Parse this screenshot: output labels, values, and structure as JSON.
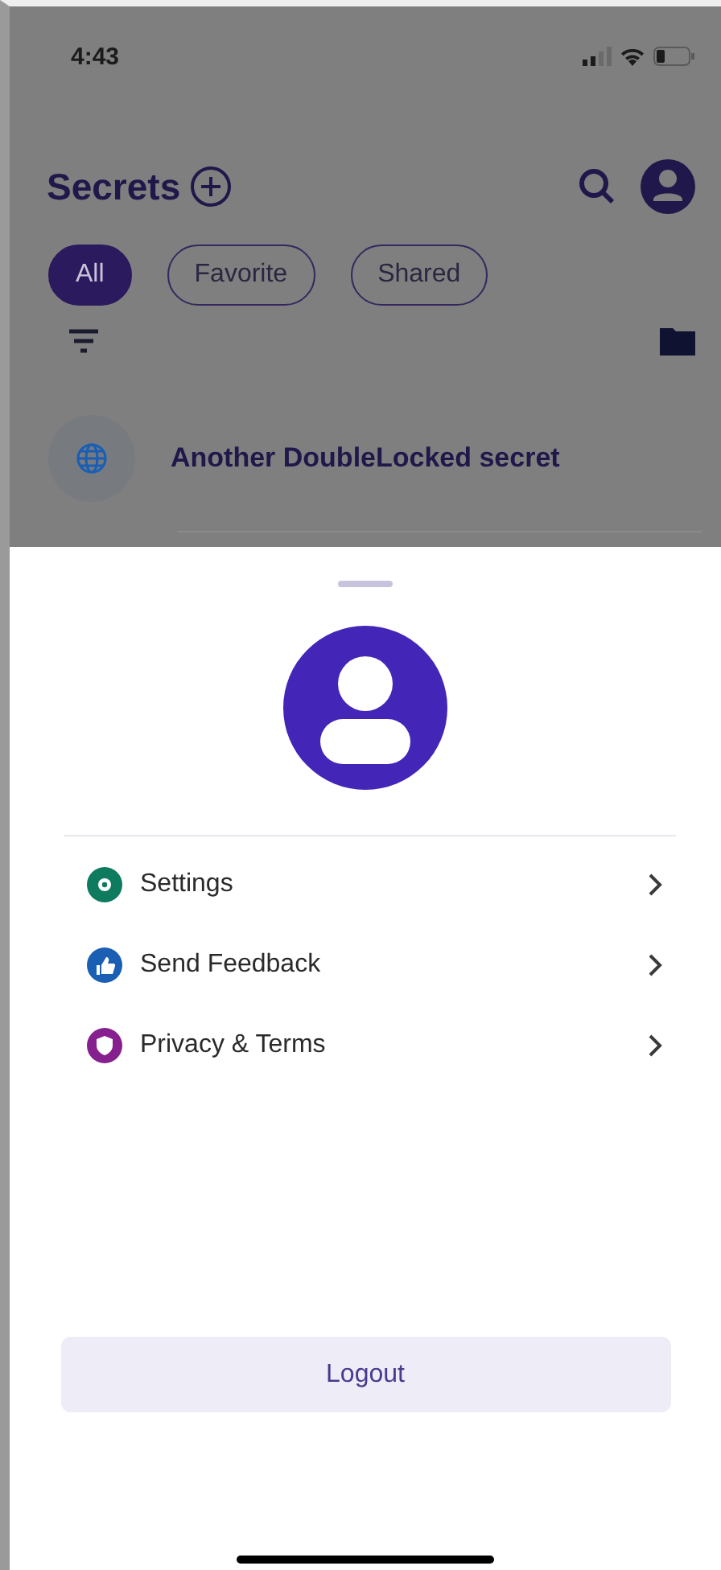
{
  "status_bar": {
    "time": "4:43"
  },
  "header": {
    "title": "Secrets"
  },
  "filters": [
    {
      "label": "All",
      "selected": true
    },
    {
      "label": "Favorite",
      "selected": false
    },
    {
      "label": "Shared",
      "selected": false
    }
  ],
  "secrets": [
    {
      "title": "Another DoubleLocked secret"
    }
  ],
  "menu": [
    {
      "label": "Settings",
      "kind": "gear",
      "color": "#0e7a5e"
    },
    {
      "label": "Send Feedback",
      "kind": "thumb",
      "color": "#1a5fb4"
    },
    {
      "label": "Privacy & Terms",
      "kind": "shield",
      "color": "#86208e"
    }
  ],
  "logout_button": {
    "label": "Logout"
  }
}
